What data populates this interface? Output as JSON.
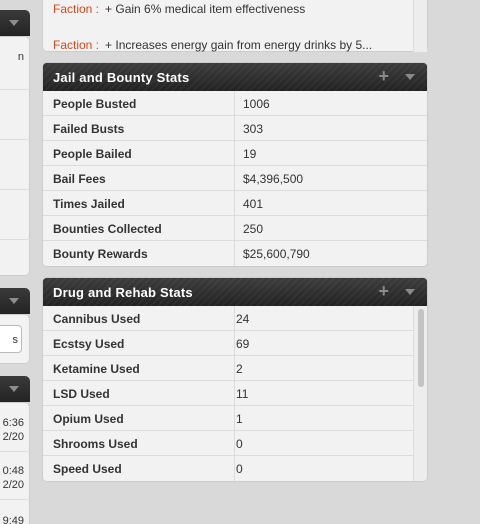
{
  "left_column": {
    "fragments": [
      "n",
      "s",
      "6:36",
      "2/20",
      "0:48",
      "2/20",
      "9:49"
    ]
  },
  "faction": {
    "rows": [
      {
        "label": "Faction :",
        "text": "+ Gain 6% medical item effectiveness"
      },
      {
        "label": "Faction :",
        "text": "+ Increases energy gain from energy drinks by 5..."
      }
    ]
  },
  "jail_panel": {
    "title": "Jail and Bounty Stats",
    "plus": "+",
    "rows": [
      {
        "key": "People Busted",
        "value": "1006"
      },
      {
        "key": "Failed Busts",
        "value": "303"
      },
      {
        "key": "People Bailed",
        "value": "19"
      },
      {
        "key": "Bail Fees",
        "value": "$4,396,500"
      },
      {
        "key": "Times Jailed",
        "value": "401"
      },
      {
        "key": "Bounties Collected",
        "value": "250"
      },
      {
        "key": "Bounty Rewards",
        "value": "$25,600,790"
      }
    ]
  },
  "drug_panel": {
    "title": "Drug and Rehab Stats",
    "plus": "+",
    "rows": [
      {
        "key": "Cannibus Used",
        "value": "24"
      },
      {
        "key": "Ecstsy Used",
        "value": "69"
      },
      {
        "key": "Ketamine Used",
        "value": "2"
      },
      {
        "key": "LSD Used",
        "value": "11"
      },
      {
        "key": "Opium Used",
        "value": "1"
      },
      {
        "key": "Shrooms Used",
        "value": "0"
      },
      {
        "key": "Speed Used",
        "value": "0"
      }
    ]
  }
}
